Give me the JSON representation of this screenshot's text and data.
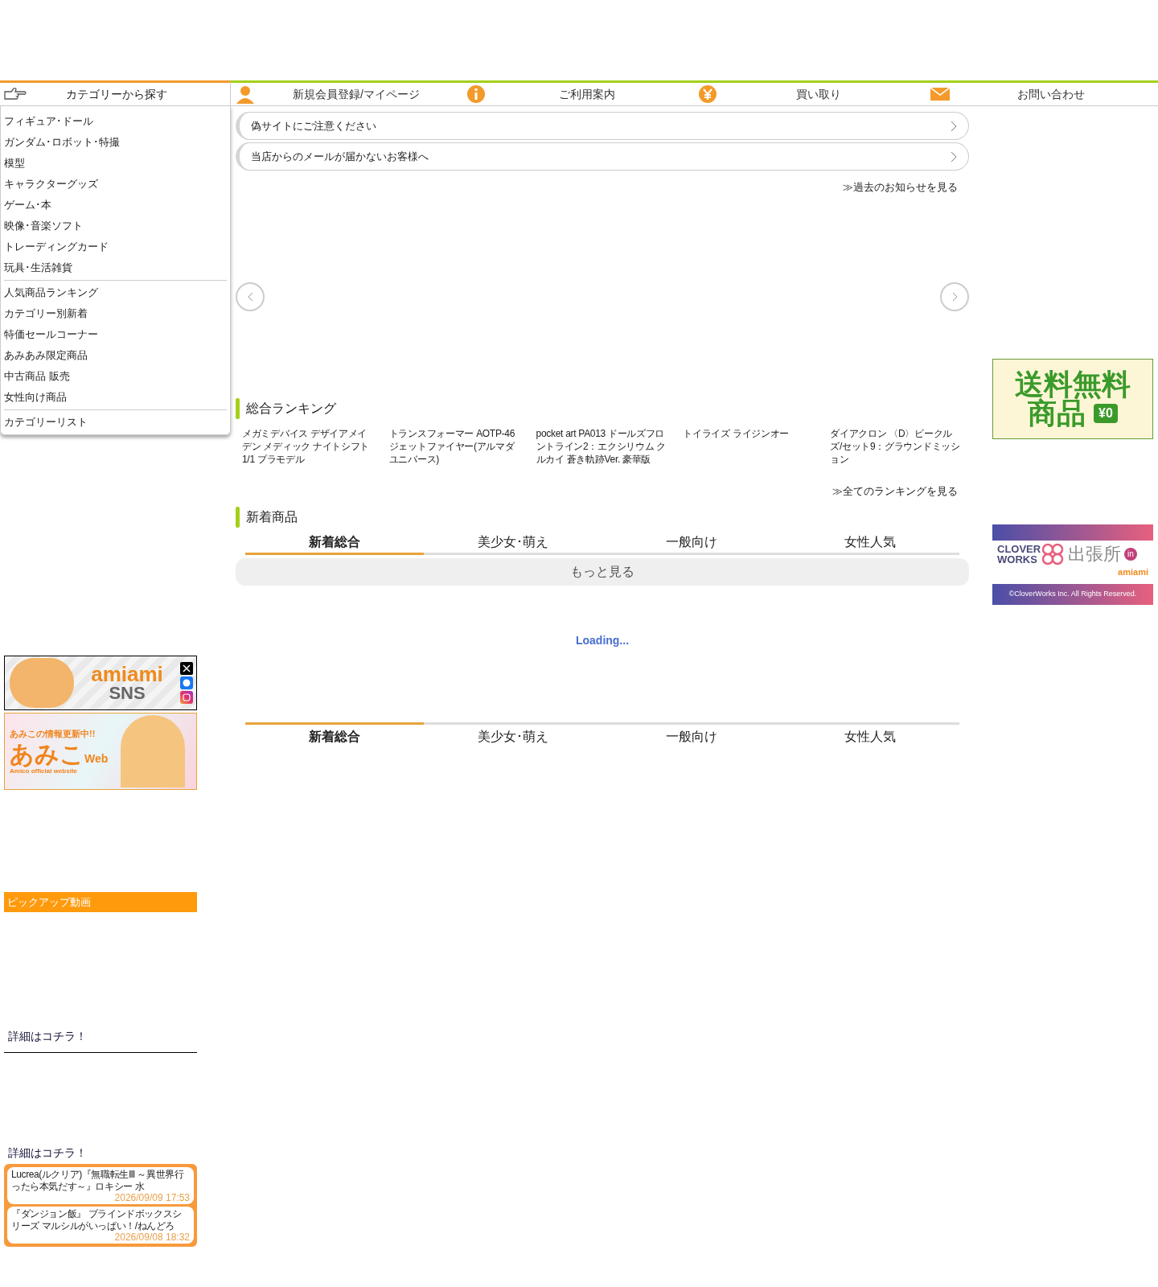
{
  "nav": {
    "category_header": "カテゴリーから探す",
    "items": [
      {
        "kind": "person",
        "label": "新規会員登録/マイページ"
      },
      {
        "kind": "info",
        "label": "ご利用案内"
      },
      {
        "kind": "yen",
        "label": "買い取り"
      },
      {
        "kind": "mail",
        "label": "お問い合わせ"
      }
    ]
  },
  "sidebar": {
    "groups": [
      [
        "フィギュア･ドール",
        "ガンダム･ロボット･特撮",
        "模型",
        "キャラクターグッズ",
        "ゲーム･本",
        "映像･音楽ソフト",
        "トレーディングカード",
        "玩具･生活雑貨"
      ],
      [
        "人気商品ランキング",
        "カテゴリー別新着",
        "特価セールコーナー",
        "あみあみ限定商品",
        "中古商品 販売",
        "女性向け商品"
      ],
      [
        "カテゴリーリスト"
      ]
    ]
  },
  "sns_banner": {
    "logo": "amiami",
    "caption": "SNS"
  },
  "amico_banner": {
    "headline": "あみこの情報更新中!!",
    "logo": "あみこ",
    "logo_suffix": "Web",
    "tagline": "Amico official website"
  },
  "pickup_video": {
    "title": "ピックアップ動画",
    "details_links": [
      "詳細はコチラ！",
      "詳細はコチラ！"
    ]
  },
  "news": [
    {
      "title": "Lucrea(ルクリア)『無職転生Ⅲ ～異世界行ったら本気だす～』ロキシー 水",
      "date": "2026/09/09 17:53"
    },
    {
      "title": "『ダンジョン飯』 ブラインドボックスシリーズ マルシルがいっぱい！/ねんどろ",
      "date": "2026/09/08 18:32"
    }
  ],
  "notices": [
    "偽サイトにご注意ください",
    "当店からのメールが届かないお客様へ"
  ],
  "past_notices_link": "≫過去のお知らせを見る",
  "ranking": {
    "title": "総合ランキング",
    "items": [
      "メガミデバイス デザイアメイデン メディック ナイトシフト 1/1 プラモデル",
      "トランスフォーマー AOTP-46 ジェットファイヤー(アルマダユニバース)",
      "pocket art PA013 ドールズフロントライン2：エクシリウム クルカイ 蒼き軌跡Ver. 豪華版",
      "トイライズ ライジンオー",
      "ダイアクロン 〈D〉ビークルズ/セット9：グラウンドミッション"
    ],
    "all_link": "≫全てのランキングを見る"
  },
  "new_arrivals": {
    "title": "新着商品",
    "tabs": [
      {
        "label": "新着総合",
        "selected": true
      },
      {
        "label": "美少女･萌え",
        "selected": false
      },
      {
        "label": "一般向け",
        "selected": false
      },
      {
        "label": "女性人気",
        "selected": false
      }
    ],
    "more_button": "もっと見る",
    "loading": "Loading...",
    "tabs_2": [
      {
        "label": "新着総合",
        "selected": true
      },
      {
        "label": "美少女･萌え",
        "selected": false
      },
      {
        "label": "一般向け",
        "selected": false
      },
      {
        "label": "女性人気",
        "selected": false
      }
    ]
  },
  "free_shipping_banner": {
    "line_1": "送料無料",
    "line_2": "商品",
    "price": "¥0"
  },
  "cloverworks_banner": {
    "logo": "CLOVER WORKS",
    "title": "出張所",
    "badge": "in",
    "shop": "amiami",
    "copyright": "©CloverWorks Inc. All Rights Reserved."
  }
}
